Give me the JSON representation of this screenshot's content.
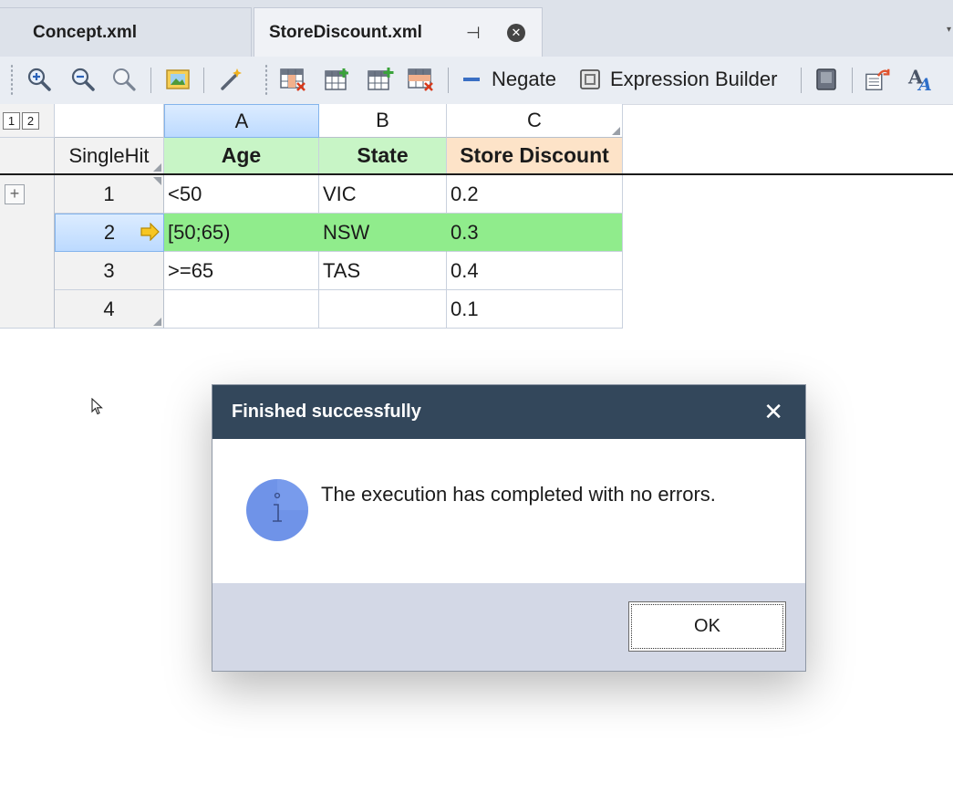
{
  "tabs": [
    {
      "label": "Concept.xml",
      "active": false
    },
    {
      "label": "StoreDiscount.xml",
      "active": true
    }
  ],
  "toolbar": {
    "negate_label": "Negate",
    "expression_builder_label": "Expression Builder",
    "icons": [
      "zoom-in-icon",
      "zoom-out-icon",
      "zoom-reset-icon",
      "image-icon",
      "magic-wand-icon",
      "delete-column-icon",
      "insert-column-icon",
      "add-column-icon",
      "delete-row-icon",
      "negate-icon",
      "expression-builder-icon",
      "book-icon",
      "export-icon",
      "font-icon"
    ]
  },
  "grid": {
    "outline_levels": [
      "1",
      "2"
    ],
    "column_letters": [
      "A",
      "B",
      "C"
    ],
    "hit_policy": "SingleHit",
    "headers": [
      "Age",
      "State",
      "Store Discount"
    ],
    "header_colors": {
      "Age": "#c8f5c6",
      "State": "#c8f5c6",
      "Store Discount": "#fde3c8"
    },
    "rows": [
      {
        "num": "1",
        "age": "<50",
        "state": "VIC",
        "discount": "0.2"
      },
      {
        "num": "2",
        "age": "[50;65)",
        "state": "NSW",
        "discount": "0.3"
      },
      {
        "num": "3",
        "age": ">=65",
        "state": "TAS",
        "discount": "0.4"
      },
      {
        "num": "4",
        "age": "",
        "state": "",
        "discount": "0.1"
      }
    ],
    "highlight_color": "#90ec8c"
  },
  "dialog": {
    "title": "Finished successfully",
    "message": "The execution has completed with no errors.",
    "ok_label": "OK",
    "title_bar_color": "#33475b",
    "footer_color": "#d3d8e6"
  }
}
